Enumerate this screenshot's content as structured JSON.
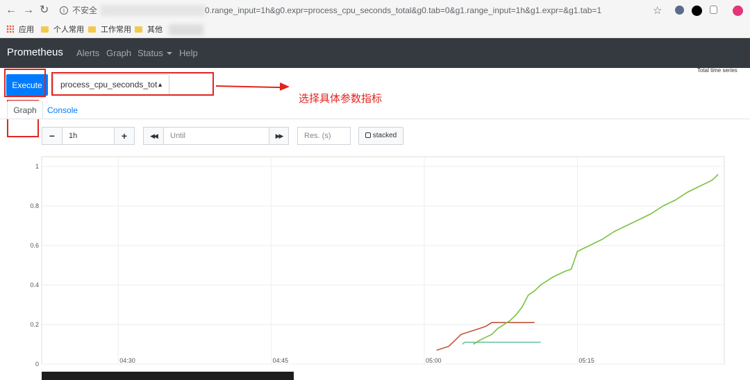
{
  "browser": {
    "back_icon": "arrow-left-icon",
    "forward_icon": "arrow-right-icon",
    "reload_icon": "reload-icon",
    "security_label": "不安全",
    "url_visible": "0.range_input=1h&g0.expr=process_cpu_seconds_total&g0.tab=0&g1.range_input=1h&g1.expr=&g1.tab=1"
  },
  "bookmarks": {
    "items": [
      {
        "label": "应用",
        "icon": "apps-icon"
      },
      {
        "label": "个人常用",
        "icon": "folder-icon"
      },
      {
        "label": "工作常用",
        "icon": "folder-icon"
      },
      {
        "label": "其他",
        "icon": "folder-icon"
      }
    ]
  },
  "navbar": {
    "brand": "Prometheus",
    "links": [
      "Alerts",
      "Graph",
      "Status",
      "Help"
    ]
  },
  "header": {
    "total_series": "Total time series"
  },
  "query": {
    "execute_label": "Execute",
    "selected_metric": "process_cpu_seconds_tot"
  },
  "annotation": {
    "text": "选择具体参数指标",
    "color": "#e3231e"
  },
  "tabs": {
    "graph": "Graph",
    "console": "Console"
  },
  "controls": {
    "minus": "−",
    "range": "1h",
    "plus": "+",
    "back": "◀◀",
    "until_placeholder": "Until",
    "forward": "▶▶",
    "res_placeholder": "Res. (s)",
    "stacked": "stacked"
  },
  "colors": {
    "accent": "#007bff",
    "navbar": "#343a40"
  },
  "chart_data": {
    "type": "line",
    "x_ticks": [
      "04:30",
      "04:45",
      "05:00",
      "05:15"
    ],
    "y_ticks": [
      "0",
      "0.2",
      "0.4",
      "0.6",
      "0.8",
      "1"
    ],
    "ylim": [
      0,
      1
    ],
    "grid": true,
    "series": [
      {
        "color": "#c0543c",
        "points": [
          [
            5.02,
            0.07
          ],
          [
            5.04,
            0.09
          ],
          [
            5.06,
            0.15
          ],
          [
            5.09,
            0.18
          ],
          [
            5.1,
            0.19
          ],
          [
            5.11,
            0.21
          ],
          [
            5.18,
            0.21
          ]
        ]
      },
      {
        "color": "#6bc1a0",
        "points": [
          [
            5.062,
            0.1
          ],
          [
            5.066,
            0.11
          ],
          [
            5.19,
            0.11
          ]
        ]
      },
      {
        "color": "#79c13e",
        "points": [
          [
            5.08,
            0.1
          ],
          [
            5.09,
            0.12
          ],
          [
            5.11,
            0.15
          ],
          [
            5.12,
            0.18
          ],
          [
            5.14,
            0.22
          ],
          [
            5.15,
            0.25
          ],
          [
            5.16,
            0.29
          ],
          [
            5.17,
            0.35
          ],
          [
            5.18,
            0.37
          ],
          [
            5.19,
            0.4
          ],
          [
            5.21,
            0.44
          ],
          [
            5.23,
            0.47
          ],
          [
            5.24,
            0.48
          ],
          [
            5.25,
            0.57
          ],
          [
            5.27,
            0.6
          ],
          [
            5.29,
            0.63
          ],
          [
            5.31,
            0.67
          ],
          [
            5.33,
            0.7
          ],
          [
            5.35,
            0.73
          ],
          [
            5.37,
            0.76
          ],
          [
            5.39,
            0.8
          ],
          [
            5.41,
            0.83
          ],
          [
            5.43,
            0.87
          ],
          [
            5.45,
            0.9
          ],
          [
            5.47,
            0.93
          ],
          [
            5.48,
            0.96
          ]
        ]
      }
    ]
  }
}
